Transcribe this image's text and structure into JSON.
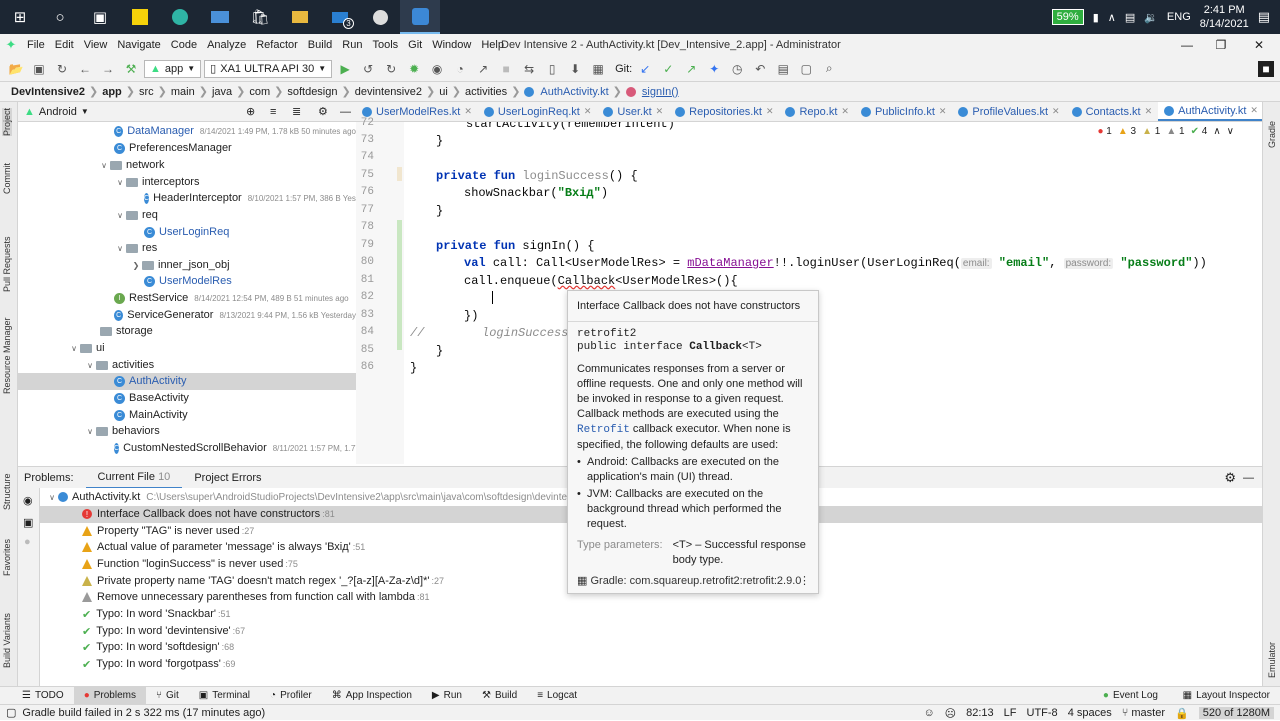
{
  "taskbar": {
    "mail_badge": "3",
    "battery": "59%",
    "language": "ENG",
    "time": "2:41 PM",
    "date": "8/14/2021"
  },
  "menu": {
    "items": [
      "File",
      "Edit",
      "View",
      "Navigate",
      "Code",
      "Analyze",
      "Refactor",
      "Build",
      "Run",
      "Tools",
      "Git",
      "Window",
      "Help"
    ],
    "window_title": "Dev Intensive 2 - AuthActivity.kt [Dev_Intensive_2.app] - Administrator"
  },
  "toolbar": {
    "module": "app",
    "device": "XA1 ULTRA API 30",
    "git_label": "Git:"
  },
  "breadcrumb": [
    "DevIntensive2",
    "app",
    "src",
    "main",
    "java",
    "com",
    "softdesign",
    "devintensive2",
    "ui",
    "activities",
    "AuthActivity.kt",
    "signIn()"
  ],
  "project": {
    "view": "Android",
    "rows": [
      {
        "name": "DataManager",
        "meta": "8/14/2021 1:49 PM, 1.78 kB 50 minutes ago",
        "icon": "class"
      },
      {
        "name": "PreferencesManager",
        "meta": "",
        "icon": "class"
      },
      {
        "name": "network",
        "meta": "",
        "icon": "folder"
      },
      {
        "name": "interceptors",
        "meta": "",
        "icon": "folder"
      },
      {
        "name": "HeaderInterceptor",
        "meta": "8/10/2021 1:57 PM, 386 B Yester",
        "icon": "class"
      },
      {
        "name": "req",
        "meta": "",
        "icon": "folder"
      },
      {
        "name": "UserLoginReq",
        "meta": "",
        "icon": "class"
      },
      {
        "name": "res",
        "meta": "",
        "icon": "folder"
      },
      {
        "name": "inner_json_obj",
        "meta": "",
        "icon": "folder"
      },
      {
        "name": "UserModelRes",
        "meta": "",
        "icon": "class"
      },
      {
        "name": "RestService",
        "meta": "8/14/2021 12:54 PM, 489 B 51 minutes ago",
        "icon": "interface"
      },
      {
        "name": "ServiceGenerator",
        "meta": "8/13/2021 9:44 PM, 1.56 kB Yesterday",
        "icon": "class"
      },
      {
        "name": "storage",
        "meta": "",
        "icon": "folder"
      },
      {
        "name": "ui",
        "meta": "",
        "icon": "folder"
      },
      {
        "name": "activities",
        "meta": "",
        "icon": "folder"
      },
      {
        "name": "AuthActivity",
        "meta": "",
        "icon": "class"
      },
      {
        "name": "BaseActivity",
        "meta": "",
        "icon": "class"
      },
      {
        "name": "MainActivity",
        "meta": "",
        "icon": "class"
      },
      {
        "name": "behaviors",
        "meta": "",
        "icon": "folder"
      },
      {
        "name": "CustomNestedScrollBehavior",
        "meta": "8/11/2021 1:57 PM, 1.77",
        "icon": "class"
      }
    ]
  },
  "editor": {
    "tabs": [
      "UserModelRes.kt",
      "UserLoginReq.kt",
      "User.kt",
      "Repositories.kt",
      "Repo.kt",
      "PublicInfo.kt",
      "ProfileValues.kt",
      "Contacts.kt",
      "AuthActivity.kt"
    ],
    "status": {
      "errors": "1",
      "warnings": "3",
      "weak": "1",
      "info": "1",
      "ok": "4"
    },
    "line_numbers": [
      "72",
      "73",
      "74",
      "75",
      "76",
      "77",
      "78",
      "79",
      "80",
      "81",
      "82",
      "83",
      "84",
      "85",
      "86"
    ],
    "code": {
      "l72": "startActivity(rememberIntent)",
      "l75_kw": "private fun",
      "l75_fn": "loginSuccess",
      "l75_rest": "() {",
      "l76_fn": "showSnackbar(",
      "l76_str": "\"Вхід\"",
      "l76_end": ")",
      "l79_kw": "private fun",
      "l79_rest": "signIn() {",
      "l80_kw": "val",
      "l80_a": "call: Call<UserModelRes> = ",
      "l80_field": "mDataManager",
      "l80_b": "!!.loginUser(UserLoginReq(",
      "l80_hint1": "email:",
      "l80_s1": "\"email\"",
      "l80_hint2": "password:",
      "l80_s2": "\"password\"",
      "l80_end": "))",
      "l81_a": "call.enqueue(",
      "l81_err": "Callback",
      "l81_b": "<UserModelRes>(){",
      "l83": "})",
      "l84_cmt_a": "//",
      "l84_cmt_b": "loginSuccess()",
      "l73": "}",
      "l77": "}",
      "l85": "}",
      "l86": "}"
    }
  },
  "popup": {
    "title": "Interface Callback does not have constructors",
    "package": "retrofit2",
    "decl_a": "public interface ",
    "decl_b": "Callback",
    "decl_c": "<T>",
    "body_a": "Communicates responses from a server or offline requests. One and only one method will be invoked in response to a given request. Callback methods are executed using the",
    "body_code": "Retrofit",
    "body_b": "callback executor. When none is specified, the following defaults are used:",
    "bullet1": "Android: Callbacks are executed on the application's main (UI) thread.",
    "bullet2": "JVM: Callbacks are executed on the background thread which performed the request.",
    "tparam_label": "Type parameters:",
    "tparam_text": "<T> – Successful response body type.",
    "gradle": "Gradle: com.squareup.retrofit2:retrofit:2.9.0"
  },
  "problems": {
    "label": "Problems:",
    "tab_current": "Current File",
    "tab_current_count": "10",
    "tab_project": "Project Errors",
    "file": "AuthActivity.kt",
    "path": "C:\\Users\\super\\AndroidStudioProjects\\DevIntensive2\\app\\src\\main\\java\\com\\softdesign\\devintens",
    "rows": [
      {
        "type": "error",
        "text": "Interface Callback does not have constructors",
        "line": ":81"
      },
      {
        "type": "warning",
        "text": "Property \"TAG\" is never used",
        "line": ":27"
      },
      {
        "type": "warning",
        "text": "Actual value of parameter 'message' is always 'Вхід'",
        "line": ":51"
      },
      {
        "type": "warning",
        "text": "Function \"loginSuccess\" is never used",
        "line": ":75"
      },
      {
        "type": "weak",
        "text": "Private property name 'TAG' doesn't match regex '_?[a-z][A-Za-z\\d]*'",
        "line": ":27"
      },
      {
        "type": "weak",
        "text": "Remove unnecessary parentheses from function call with lambda",
        "line": ":81"
      },
      {
        "type": "typo",
        "text": "Typo: In word 'Snackbar'",
        "line": ":51"
      },
      {
        "type": "typo",
        "text": "Typo: In word 'devintensive'",
        "line": ":67"
      },
      {
        "type": "typo",
        "text": "Typo: In word 'softdesign'",
        "line": ":68"
      },
      {
        "type": "typo",
        "text": "Typo: In word 'forgotpass'",
        "line": ":69"
      }
    ]
  },
  "left_strip": [
    "Project",
    "Commit",
    "Pull Requests",
    "Resource Manager",
    "Structure",
    "Favorites",
    "Build Variants"
  ],
  "right_strip": [
    "Gradle",
    "Emulator"
  ],
  "bottom_tools": [
    "TODO",
    "Problems",
    "Git",
    "Terminal",
    "Profiler",
    "App Inspection",
    "Run",
    "Build",
    "Logcat"
  ],
  "bottom_right_tools": [
    "Event Log",
    "Layout Inspector"
  ],
  "statusbar": {
    "message": "Gradle build failed in 2 s 322 ms (17 minutes ago)",
    "position": "82:13",
    "line_sep": "LF",
    "encoding": "UTF-8",
    "indent": "4 spaces",
    "branch": "master",
    "memory": "520 of 1280M"
  }
}
